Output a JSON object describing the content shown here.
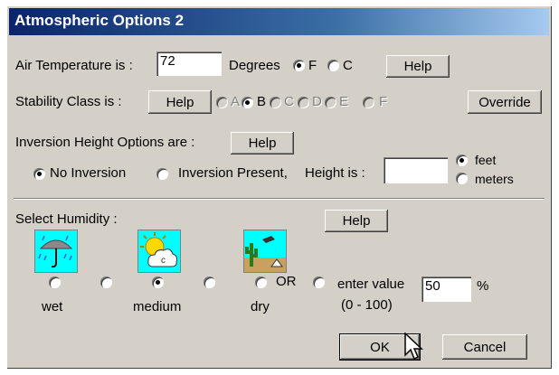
{
  "window": {
    "title": "Atmospheric Options 2"
  },
  "temperature": {
    "label": "Air Temperature is :",
    "value": "72",
    "units_label": "Degrees",
    "option_f": "F",
    "option_c": "C",
    "selected": "F",
    "help": "Help"
  },
  "stability": {
    "label": "Stability Class is :",
    "help": "Help",
    "classes": [
      "A",
      "B",
      "C",
      "D",
      "E",
      "F"
    ],
    "selected": "B",
    "override": "Override"
  },
  "inversion": {
    "label": "Inversion Height Options are :",
    "help": "Help",
    "no_inversion": "No Inversion",
    "present": "Inversion Present,",
    "height_label": "Height is :",
    "height_value": "",
    "unit_feet": "feet",
    "unit_meters": "meters",
    "selected": "No Inversion",
    "selected_unit": "feet"
  },
  "humidity": {
    "label": "Select Humidity :",
    "help": "Help",
    "wet": "wet",
    "medium": "medium",
    "dry": "dry",
    "or": "OR",
    "enter_value": "enter value",
    "range": "(0 - 100)",
    "value": "50",
    "percent": "%",
    "selected": "medium",
    "icons": [
      "rain-umbrella-icon",
      "sun-cloud-icon",
      "desert-cactus-icon"
    ]
  },
  "buttons": {
    "ok": "OK",
    "cancel": "Cancel"
  }
}
